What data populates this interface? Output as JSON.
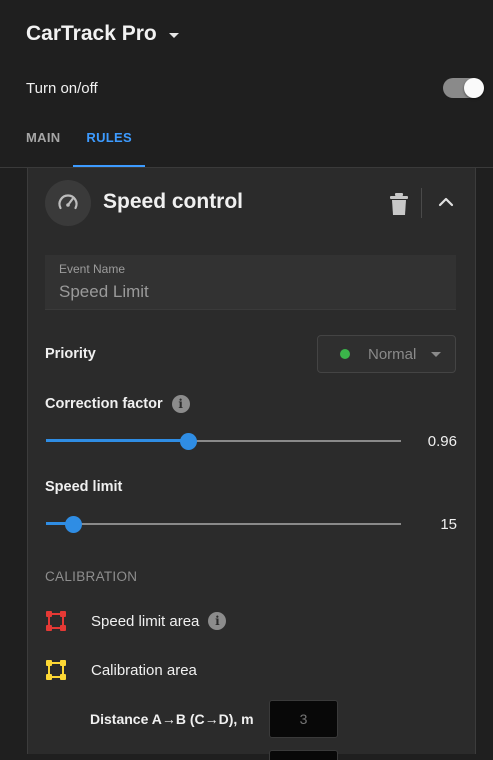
{
  "app": {
    "title": "CarTrack Pro"
  },
  "power": {
    "label": "Turn on/off",
    "enabled": true
  },
  "tabs": [
    {
      "label": "MAIN",
      "active": false
    },
    {
      "label": "RULES",
      "active": true
    }
  ],
  "rule": {
    "title": "Speed control",
    "icon": "speedometer-icon",
    "event_name": {
      "label": "Event Name",
      "value": "Speed Limit"
    },
    "priority": {
      "label": "Priority",
      "value": "Normal",
      "status_color": "#3bb54a"
    },
    "correction": {
      "label": "Correction factor",
      "value": "0.96",
      "fraction": 0.4
    },
    "speed_limit": {
      "label": "Speed limit",
      "value": "15",
      "fraction": 0.075
    },
    "calibration": {
      "section_label": "CALIBRATION",
      "speed_area_label": "Speed limit area",
      "speed_area_color": "#e53935",
      "calib_area_label": "Calibration area",
      "calib_area_color": "#fdd835",
      "distance_label": "Distance A→B (C→D), m",
      "distance_placeholder": "3"
    }
  },
  "colors": {
    "accent": "#3d9bff",
    "slider": "#2f8de4"
  }
}
